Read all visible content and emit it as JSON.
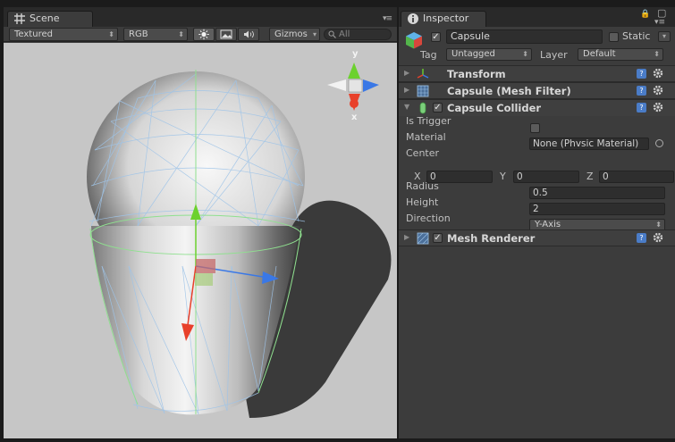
{
  "scene": {
    "tab_label": "Scene",
    "render_mode": "Textured",
    "color_mode": "RGB",
    "gizmos_label": "Gizmos",
    "search_placeholder": "All",
    "orientation_gizmo": {
      "y_label": "y",
      "x_label": "x"
    }
  },
  "inspector": {
    "tab_label": "Inspector",
    "object": {
      "active": true,
      "name": "Capsule",
      "static_label": "Static",
      "static": false,
      "tag_label": "Tag",
      "tag_value": "Untagged",
      "layer_label": "Layer",
      "layer_value": "Default"
    },
    "components": {
      "transform": {
        "title": "Transform"
      },
      "mesh_filter": {
        "title": "Capsule (Mesh Filter)"
      },
      "capsule_collider": {
        "title": "Capsule Collider",
        "enabled": true,
        "is_trigger_label": "Is Trigger",
        "is_trigger": false,
        "material_label": "Material",
        "material_value": "None (Phvsic Material)",
        "center_label": "Center",
        "center": {
          "x_label": "X",
          "x": "0",
          "y_label": "Y",
          "y": "0",
          "z_label": "Z",
          "z": "0"
        },
        "radius_label": "Radius",
        "radius": "0.5",
        "height_label": "Height",
        "height": "2",
        "direction_label": "Direction",
        "direction": "Y-Axis"
      },
      "mesh_renderer": {
        "title": "Mesh Renderer",
        "enabled": true
      }
    }
  },
  "colors": {
    "panel_bg": "#3c3c3c",
    "viewport_bg": "#c6c6c6",
    "wireframe": "#9fc4e8",
    "wire_green": "#8fe08f",
    "axis_x": "#e8402a",
    "axis_y": "#6cd12e",
    "axis_z": "#3a78e6",
    "help_blue": "#4a7cc7"
  }
}
